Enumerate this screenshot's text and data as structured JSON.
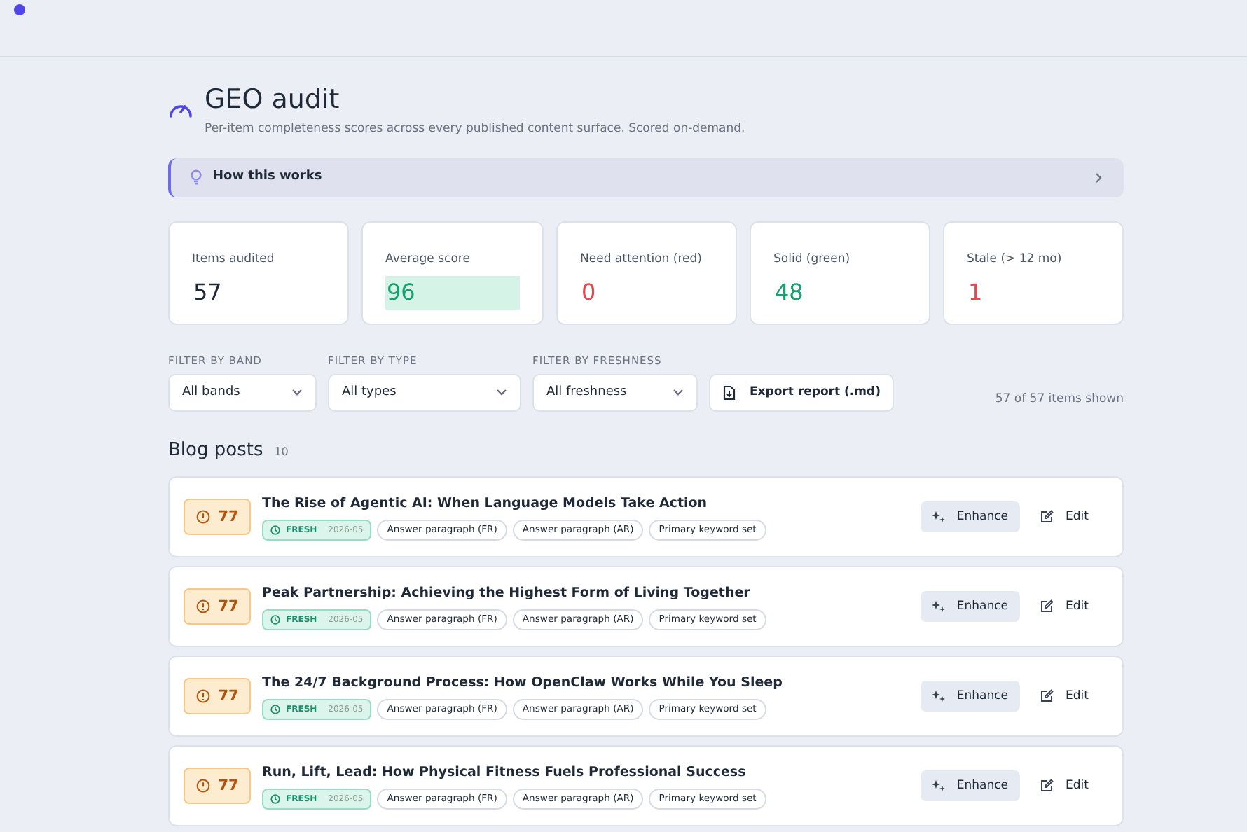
{
  "header": {
    "title": "GEO audit",
    "subtitle": "Per-item completeness scores across every published content surface. Scored on-demand."
  },
  "how_it_works": {
    "label": "How this works",
    "expanded": false
  },
  "stats": [
    {
      "label": "Items audited",
      "value": "57",
      "color": "#1f2937",
      "highlighted": false
    },
    {
      "label": "Average score",
      "value": "96",
      "color": "#16a06e",
      "highlighted": true
    },
    {
      "label": "Need attention (red)",
      "value": "0",
      "color": "#e5484d",
      "highlighted": false
    },
    {
      "label": "Solid (green)",
      "value": "48",
      "color": "#16a06e",
      "highlighted": false
    },
    {
      "label": "Stale (> 12 mo)",
      "value": "1",
      "color": "#e5484d",
      "highlighted": false
    }
  ],
  "filters": [
    {
      "label": "FILTER BY BAND",
      "value": "All bands"
    },
    {
      "label": "FILTER BY TYPE",
      "value": "All types"
    },
    {
      "label": "FILTER BY FRESHNESS",
      "value": "All freshness"
    }
  ],
  "export_button": "Export report (.md)",
  "count_text": "57 of 57 items shown",
  "section": {
    "title": "Blog posts",
    "count": "10"
  },
  "items": [
    {
      "score": "77",
      "kind": "warning",
      "title": "The Rise of Agentic AI: When Language Models Take Action",
      "freshness": {
        "kind": "fresh",
        "label": "FRESH",
        "date": "2026-05"
      },
      "tags": [
        "Answer paragraph (FR)",
        "Answer paragraph (AR)",
        "Primary keyword set"
      ],
      "actions": [
        "Enhance",
        "Edit"
      ]
    },
    {
      "score": "77",
      "kind": "warning",
      "title": "Peak Partnership: Achieving the Highest Form of Living Together",
      "freshness": {
        "kind": "fresh",
        "label": "FRESH",
        "date": "2026-05"
      },
      "tags": [
        "Answer paragraph (FR)",
        "Answer paragraph (AR)",
        "Primary keyword set"
      ],
      "actions": [
        "Enhance",
        "Edit"
      ]
    },
    {
      "score": "77",
      "kind": "warning",
      "title": "The 24/7 Background Process: How OpenClaw Works While You Sleep",
      "freshness": {
        "kind": "fresh",
        "label": "FRESH",
        "date": "2026-05"
      },
      "tags": [
        "Answer paragraph (FR)",
        "Answer paragraph (AR)",
        "Primary keyword set"
      ],
      "actions": [
        "Enhance",
        "Edit"
      ]
    },
    {
      "score": "77",
      "kind": "warning",
      "title": "Run, Lift, Lead: How Physical Fitness Fuels Professional Success",
      "freshness": {
        "kind": "fresh",
        "label": "FRESH",
        "date": "2026-05"
      },
      "tags": [
        "Answer paragraph (FR)",
        "Answer paragraph (AR)",
        "Primary keyword set"
      ],
      "actions": [
        "Enhance",
        "Edit"
      ]
    }
  ]
}
